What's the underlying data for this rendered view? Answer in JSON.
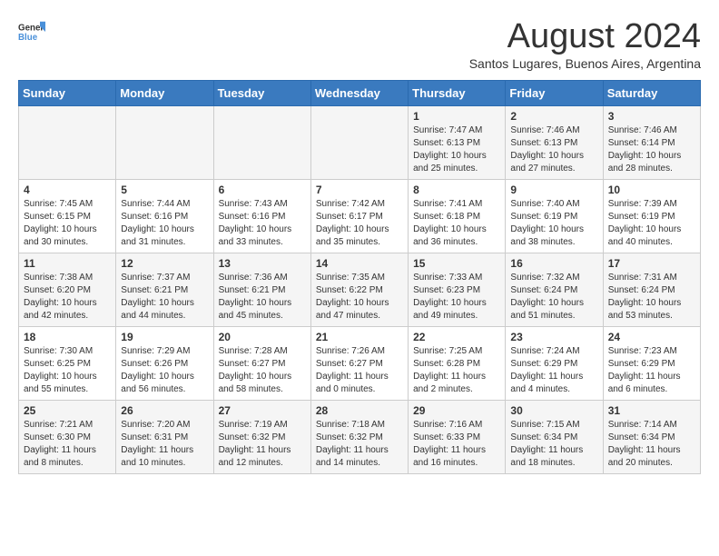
{
  "logo": {
    "general": "General",
    "blue": "Blue"
  },
  "title": "August 2024",
  "subtitle": "Santos Lugares, Buenos Aires, Argentina",
  "days_of_week": [
    "Sunday",
    "Monday",
    "Tuesday",
    "Wednesday",
    "Thursday",
    "Friday",
    "Saturday"
  ],
  "weeks": [
    [
      {
        "day": "",
        "info": ""
      },
      {
        "day": "",
        "info": ""
      },
      {
        "day": "",
        "info": ""
      },
      {
        "day": "",
        "info": ""
      },
      {
        "day": "1",
        "info": "Sunrise: 7:47 AM\nSunset: 6:13 PM\nDaylight: 10 hours and 25 minutes."
      },
      {
        "day": "2",
        "info": "Sunrise: 7:46 AM\nSunset: 6:13 PM\nDaylight: 10 hours and 27 minutes."
      },
      {
        "day": "3",
        "info": "Sunrise: 7:46 AM\nSunset: 6:14 PM\nDaylight: 10 hours and 28 minutes."
      }
    ],
    [
      {
        "day": "4",
        "info": "Sunrise: 7:45 AM\nSunset: 6:15 PM\nDaylight: 10 hours and 30 minutes."
      },
      {
        "day": "5",
        "info": "Sunrise: 7:44 AM\nSunset: 6:16 PM\nDaylight: 10 hours and 31 minutes."
      },
      {
        "day": "6",
        "info": "Sunrise: 7:43 AM\nSunset: 6:16 PM\nDaylight: 10 hours and 33 minutes."
      },
      {
        "day": "7",
        "info": "Sunrise: 7:42 AM\nSunset: 6:17 PM\nDaylight: 10 hours and 35 minutes."
      },
      {
        "day": "8",
        "info": "Sunrise: 7:41 AM\nSunset: 6:18 PM\nDaylight: 10 hours and 36 minutes."
      },
      {
        "day": "9",
        "info": "Sunrise: 7:40 AM\nSunset: 6:19 PM\nDaylight: 10 hours and 38 minutes."
      },
      {
        "day": "10",
        "info": "Sunrise: 7:39 AM\nSunset: 6:19 PM\nDaylight: 10 hours and 40 minutes."
      }
    ],
    [
      {
        "day": "11",
        "info": "Sunrise: 7:38 AM\nSunset: 6:20 PM\nDaylight: 10 hours and 42 minutes."
      },
      {
        "day": "12",
        "info": "Sunrise: 7:37 AM\nSunset: 6:21 PM\nDaylight: 10 hours and 44 minutes."
      },
      {
        "day": "13",
        "info": "Sunrise: 7:36 AM\nSunset: 6:21 PM\nDaylight: 10 hours and 45 minutes."
      },
      {
        "day": "14",
        "info": "Sunrise: 7:35 AM\nSunset: 6:22 PM\nDaylight: 10 hours and 47 minutes."
      },
      {
        "day": "15",
        "info": "Sunrise: 7:33 AM\nSunset: 6:23 PM\nDaylight: 10 hours and 49 minutes."
      },
      {
        "day": "16",
        "info": "Sunrise: 7:32 AM\nSunset: 6:24 PM\nDaylight: 10 hours and 51 minutes."
      },
      {
        "day": "17",
        "info": "Sunrise: 7:31 AM\nSunset: 6:24 PM\nDaylight: 10 hours and 53 minutes."
      }
    ],
    [
      {
        "day": "18",
        "info": "Sunrise: 7:30 AM\nSunset: 6:25 PM\nDaylight: 10 hours and 55 minutes."
      },
      {
        "day": "19",
        "info": "Sunrise: 7:29 AM\nSunset: 6:26 PM\nDaylight: 10 hours and 56 minutes."
      },
      {
        "day": "20",
        "info": "Sunrise: 7:28 AM\nSunset: 6:27 PM\nDaylight: 10 hours and 58 minutes."
      },
      {
        "day": "21",
        "info": "Sunrise: 7:26 AM\nSunset: 6:27 PM\nDaylight: 11 hours and 0 minutes."
      },
      {
        "day": "22",
        "info": "Sunrise: 7:25 AM\nSunset: 6:28 PM\nDaylight: 11 hours and 2 minutes."
      },
      {
        "day": "23",
        "info": "Sunrise: 7:24 AM\nSunset: 6:29 PM\nDaylight: 11 hours and 4 minutes."
      },
      {
        "day": "24",
        "info": "Sunrise: 7:23 AM\nSunset: 6:29 PM\nDaylight: 11 hours and 6 minutes."
      }
    ],
    [
      {
        "day": "25",
        "info": "Sunrise: 7:21 AM\nSunset: 6:30 PM\nDaylight: 11 hours and 8 minutes."
      },
      {
        "day": "26",
        "info": "Sunrise: 7:20 AM\nSunset: 6:31 PM\nDaylight: 11 hours and 10 minutes."
      },
      {
        "day": "27",
        "info": "Sunrise: 7:19 AM\nSunset: 6:32 PM\nDaylight: 11 hours and 12 minutes."
      },
      {
        "day": "28",
        "info": "Sunrise: 7:18 AM\nSunset: 6:32 PM\nDaylight: 11 hours and 14 minutes."
      },
      {
        "day": "29",
        "info": "Sunrise: 7:16 AM\nSunset: 6:33 PM\nDaylight: 11 hours and 16 minutes."
      },
      {
        "day": "30",
        "info": "Sunrise: 7:15 AM\nSunset: 6:34 PM\nDaylight: 11 hours and 18 minutes."
      },
      {
        "day": "31",
        "info": "Sunrise: 7:14 AM\nSunset: 6:34 PM\nDaylight: 11 hours and 20 minutes."
      }
    ]
  ]
}
